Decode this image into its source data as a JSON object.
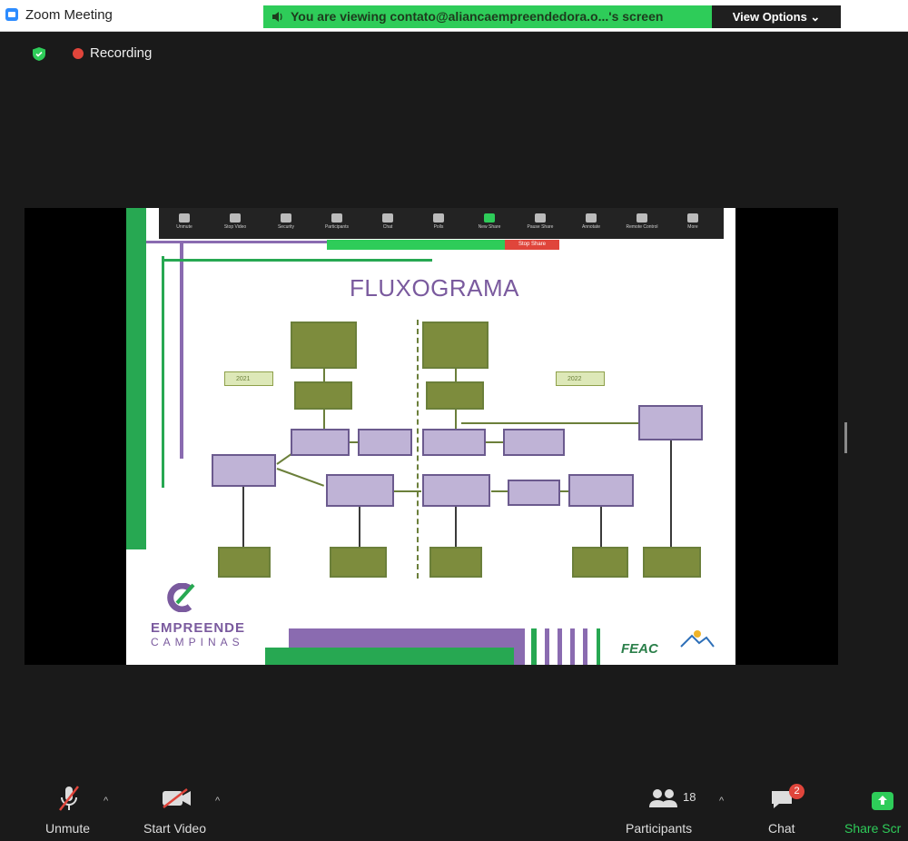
{
  "window": {
    "title": "Zoom Meeting"
  },
  "share_banner": {
    "text": "You are viewing contato@aliancaempreendedora.o...'s screen"
  },
  "view_options": {
    "label": "View Options ⌄"
  },
  "status": {
    "recording_label": "Recording"
  },
  "shared_screen": {
    "toolbar": [
      "Unmute",
      "Stop Video",
      "Security",
      "Participants",
      "Chat",
      "Polls",
      "New Share",
      "Pause Share",
      "Annotate",
      "Remote Control",
      "More"
    ],
    "mini_banner_stop": "Stop Share"
  },
  "slide": {
    "title": "FLUXOGRAMA",
    "tags": [
      "2021",
      "2022"
    ],
    "logo": {
      "name": "EMPREENDE",
      "sub": "CAMPINAS"
    },
    "partner_logo": "FEAC"
  },
  "toolbar": {
    "unmute": "Unmute",
    "start_video": "Start Video",
    "participants": "Participants",
    "participants_count": "18",
    "chat": "Chat",
    "chat_badge": "2",
    "share": "Share Scr"
  },
  "colors": {
    "share_green": "#2ecc59",
    "recording_red": "#e0453b",
    "slide_purple": "#7a5a9e",
    "box_olive": "#7d8c3d",
    "box_lavender": "#bfb3d6"
  }
}
